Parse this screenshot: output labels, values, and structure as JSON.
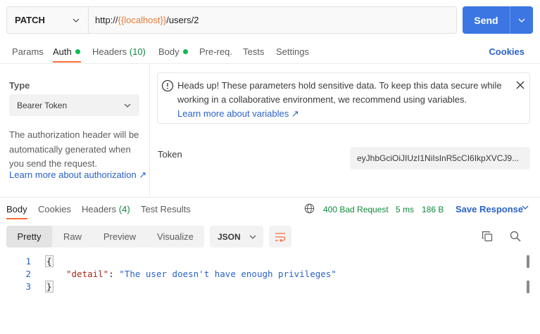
{
  "request": {
    "method": "PATCH",
    "url_prefix": "http://",
    "url_var": "{{localhost}}",
    "url_suffix": "/users/2",
    "send_label": "Send"
  },
  "request_tabs": {
    "params": "Params",
    "auth": "Auth",
    "headers": "Headers",
    "headers_count": "(10)",
    "body": "Body",
    "prereq": "Pre-req.",
    "tests": "Tests",
    "settings": "Settings",
    "cookies": "Cookies"
  },
  "auth": {
    "type_label": "Type",
    "type_value": "Bearer Token",
    "description": "The authorization header will be automatically generated when you send the request.",
    "learn_more": "Learn more about authorization ↗",
    "notice_text": "Heads up! These parameters hold sensitive data. To keep this data secure while working in a collaborative environment, we recommend using variables.",
    "notice_link": "Learn more about variables ↗",
    "token_label": "Token",
    "token_value": "eyJhbGciOiJIUzI1NiIsInR5cCI6IkpXVCJ9..."
  },
  "response_tabs": {
    "body": "Body",
    "cookies": "Cookies",
    "headers": "Headers",
    "headers_count": "(4)",
    "test_results": "Test Results",
    "status": "400 Bad Request",
    "time": "5 ms",
    "size": "186 B",
    "save_response": "Save Response"
  },
  "response_view": {
    "pretty": "Pretty",
    "raw": "Raw",
    "preview": "Preview",
    "visualize": "Visualize",
    "format": "JSON"
  },
  "response_body": {
    "line_numbers": [
      "1",
      "2",
      "3"
    ],
    "open_brace": "{",
    "key": "\"detail\"",
    "colon": ": ",
    "value": "\"The user doesn't have enough privileges\"",
    "close_brace": "}"
  },
  "colors": {
    "accent_orange": "#ff6c37",
    "send_blue": "#3b76e3",
    "status_green": "#0f8a3c",
    "link_blue": "#2a62c9"
  }
}
